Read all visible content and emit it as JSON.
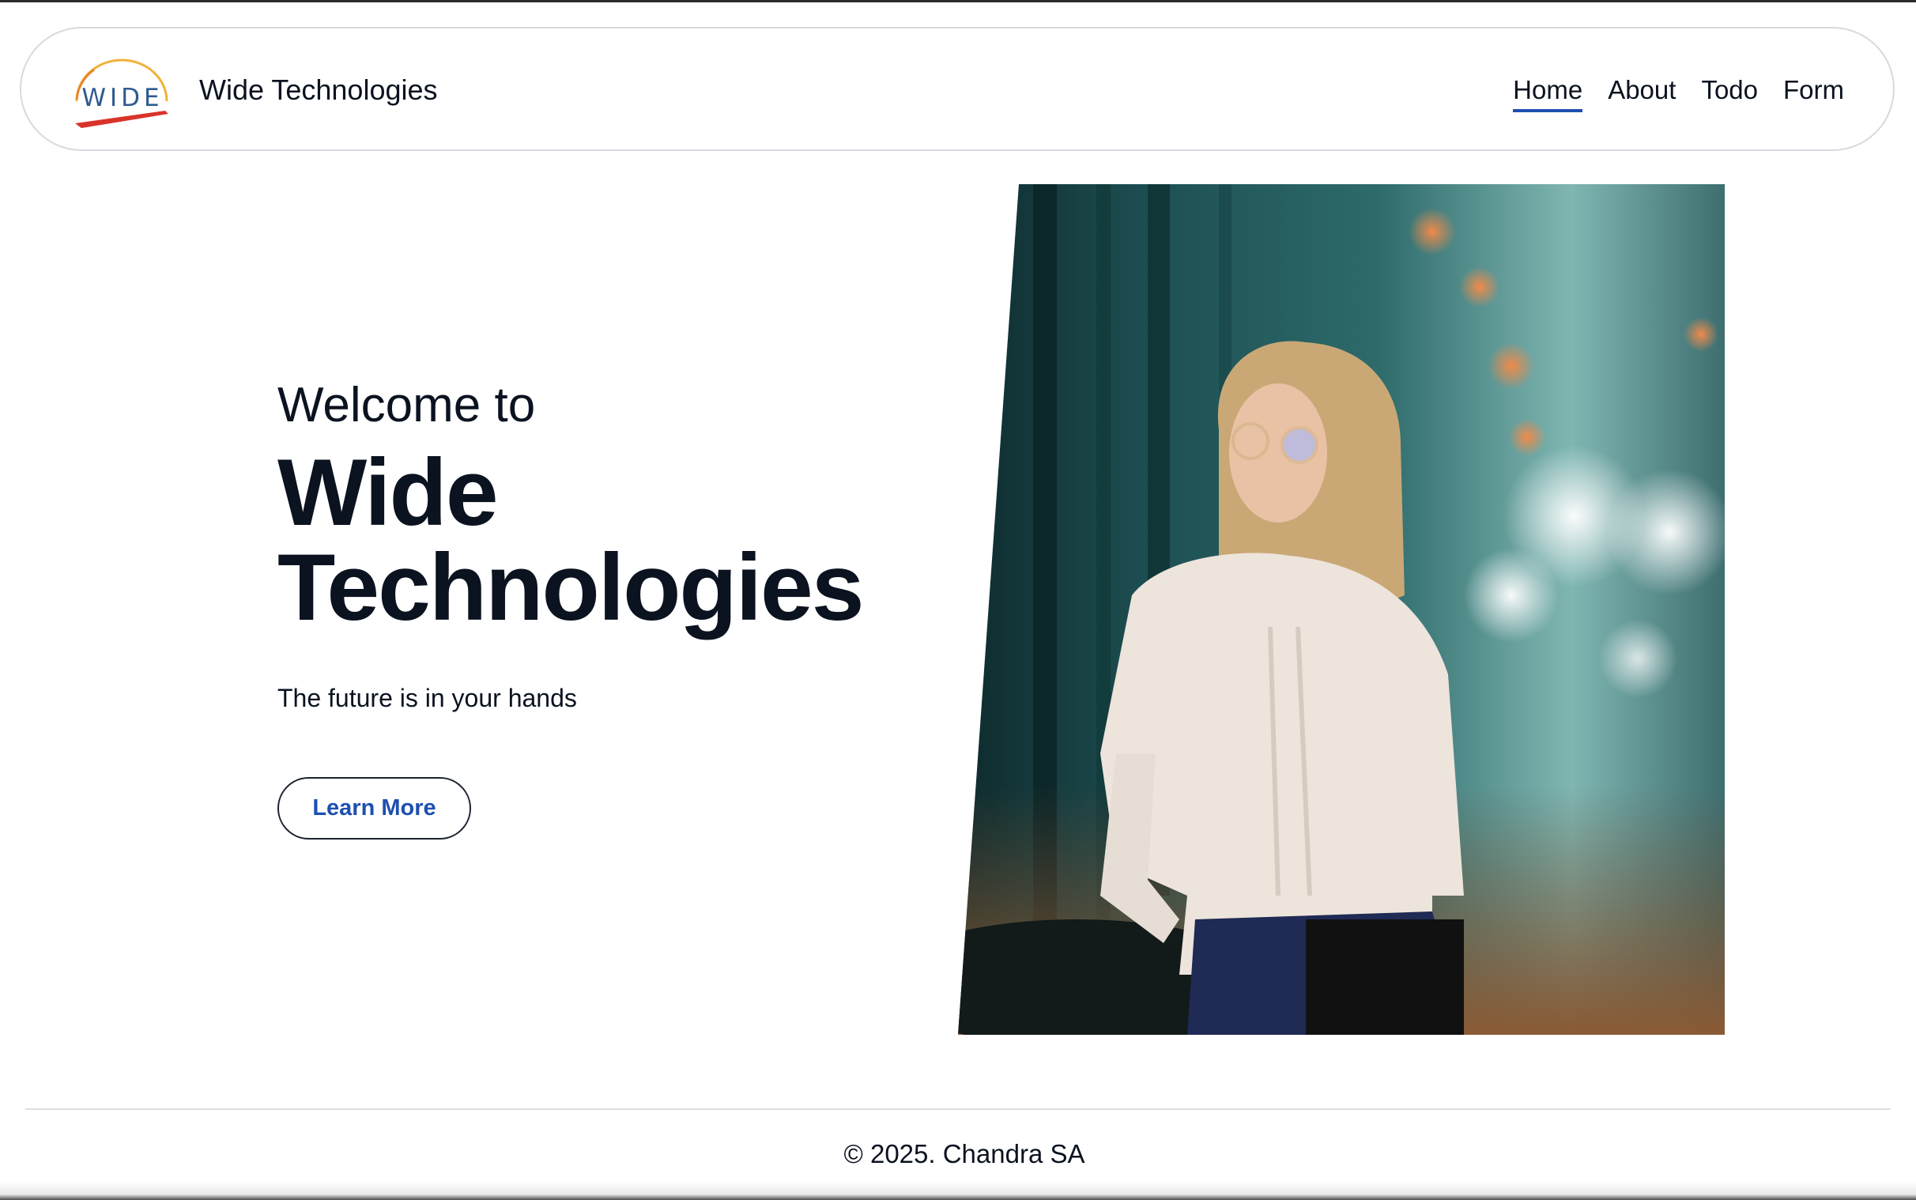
{
  "header": {
    "logo_text": "WIDE",
    "brand_name": "Wide Technologies",
    "nav": [
      {
        "label": "Home",
        "active": true
      },
      {
        "label": "About",
        "active": false
      },
      {
        "label": "Todo",
        "active": false
      },
      {
        "label": "Form",
        "active": false
      }
    ]
  },
  "hero": {
    "welcome": "Welcome to",
    "title_line1": "Wide",
    "title_line2": "Technologies",
    "tagline": "The future is in your hands",
    "cta_label": "Learn More",
    "image_icon": "photo-woman-glasses-sweater"
  },
  "footer": {
    "copyright": "© 2025. Chandra SA"
  },
  "colors": {
    "accent": "#1e4fb0",
    "text": "#0b1220",
    "logo_arc": "#f0b23c",
    "logo_swoosh": "#d9342b"
  }
}
